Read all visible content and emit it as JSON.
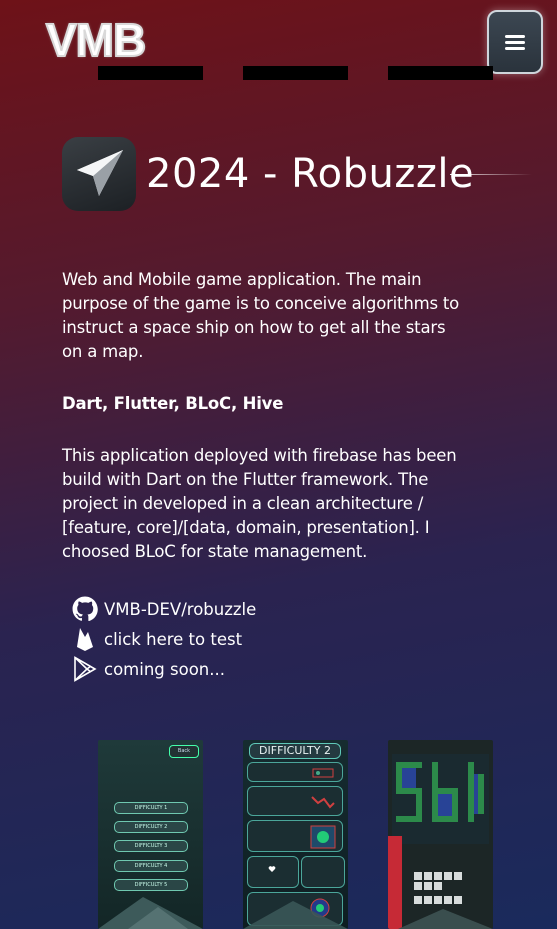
{
  "header": {
    "logo": "VMB",
    "menu_icon": "hamburger-icon"
  },
  "project": {
    "title": "2024 - Robuzzle",
    "app_icon": "paper-plane-icon",
    "description": "Web and Mobile game application. The main purpose of the game is to conceive algorithms to instruct a space ship on how to get all the stars on a map.",
    "stack": "Dart, Flutter, BLoC, Hive",
    "details": "This application deployed with firebase has been build with Dart on the Flutter framework. The project in developed in a clean architecture / [feature, core]/[data, domain, presentation]. I choosed BLoC for state management."
  },
  "links": [
    {
      "icon": "github-icon",
      "label": "VMB-DEV/robuzzle"
    },
    {
      "icon": "firebase-icon",
      "label": "click here to test"
    },
    {
      "icon": "google-play-icon",
      "label": "coming soon..."
    }
  ],
  "screenshots": {
    "s1": {
      "top_button": "Back",
      "difficulties": [
        "DIFFICULTY 1",
        "DIFFICULTY 2",
        "DIFFICULTY 3",
        "DIFFICULTY 4",
        "DIFFICULTY 5"
      ]
    },
    "s2": {
      "heading": "DIFFICULTY 2"
    }
  },
  "colors": {
    "background_top": "#6e1218",
    "background_bottom": "#1a2a5c",
    "text": "#ffffff"
  }
}
